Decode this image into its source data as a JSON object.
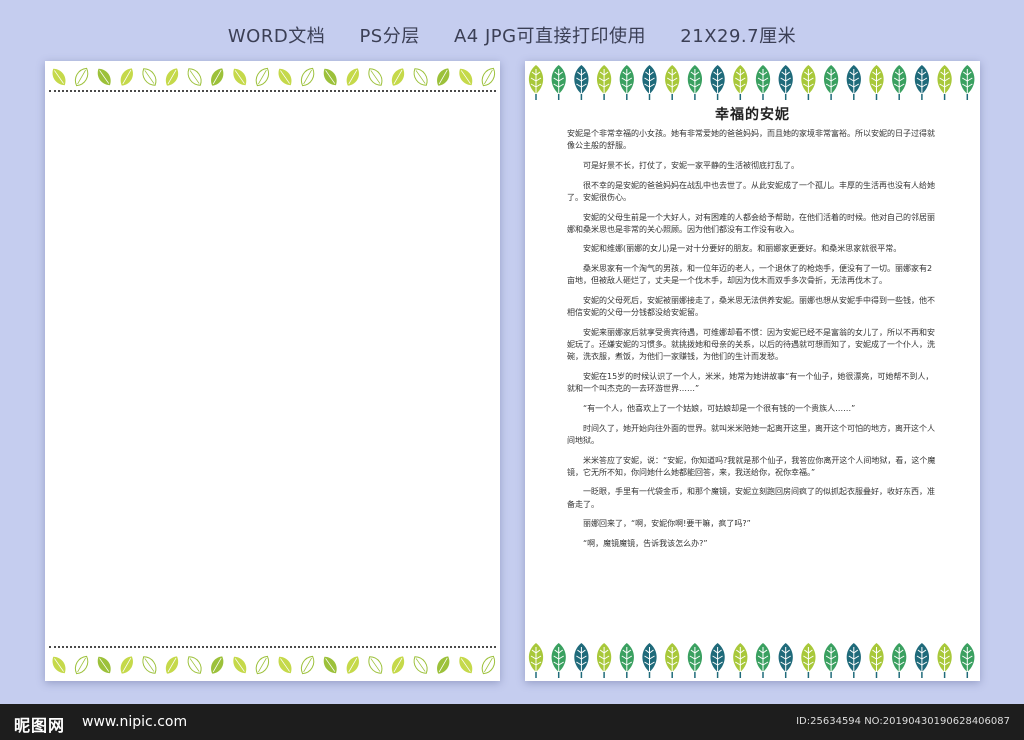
{
  "header": {
    "items": [
      "WORD文档",
      "PS分层",
      "A4 JPG可直接打印使用",
      "21X29.7厘米"
    ]
  },
  "colors": {
    "background": "#c5cdef",
    "leaf_light": "#c5d94a",
    "leaf_dark": "#9cc13a",
    "tree_dark": "#1f6a7a",
    "tree_mid": "#3aa060",
    "tree_light": "#a8c83a"
  },
  "icons": [
    "leaf-icon",
    "tree-icon"
  ],
  "document": {
    "title": "幸福的安妮",
    "paragraphs": [
      "安妮是个非常幸福的小女孩。她有非常爱她的爸爸妈妈，而且她的家境非常富裕。所以安妮的日子过得就像公主般的舒服。",
      "可是好景不长，打仗了，安妮一家平静的生活被彻底打乱了。",
      "很不幸的是安妮的爸爸妈妈在战乱中也去世了。从此安妮成了一个孤儿。丰厚的生活再也没有人给她了。安妮很伤心。",
      "安妮的父母生前是一个大好人，对有困难的人都会给予帮助，在他们活着的时候。他对自己的邻居丽娜和桑米思也是非常的关心照顾。因为他们都没有工作没有收入。",
      "安妮和维娜(丽娜的女儿)是一对十分要好的朋友。和丽娜家更要好。和桑米思家就很平常。",
      "桑米思家有一个淘气的男孩，和一位年迈的老人，一个退休了的枪炮手，便没有了一切。丽娜家有2亩地，但被敌人砸烂了，丈夫是一个伐木手，却因为伐木而双手多次骨折，无法再伐木了。",
      "安妮的父母死后，安妮被丽娜接走了，桑米思无法供养安妮。丽娜也想从安妮手中得到一些钱，他不相信安妮的父母一分钱都没给安妮留。",
      "安妮来丽娜家后就享受贵宾待遇，可维娜却看不惯：因为安妮已经不是富翁的女儿了，所以不再和安妮玩了。还嫌安妮的习惯多。就挑拨她和母亲的关系，以后的待遇就可想而知了，安妮成了一个仆人，洗碗，洗衣服，煮饭，为他们一家赚钱，为他们的生计而发愁。",
      "安妮在15岁的时候认识了一个人，米米，她常为她讲故事“有一个仙子，她很漂亮，可她帮不到人，就和一个叫杰克的一去环游世界……”",
      "“有一个人，他喜欢上了一个姑娘，可姑娘却是一个很有钱的一个贵族人……”",
      "时间久了，她开始向往外面的世界。就叫米米陪她一起离开这里，离开这个可怕的地方，离开这个人间地狱。",
      "米米答应了安妮，说：“安妮，你知道吗?我就是那个仙子，我答应你离开这个人间地狱，看，这个魔镜，它无所不知，你问她什么她都能回答，来，我送给你，祝你幸福。”",
      "一眨眼，手里有一代袋金币，和那个魔镜，安妮立刻跑回房间疯了的似抓起衣服叠好，收好东西，准备走了。",
      "丽娜回来了，“啊，安妮你啊!要干嘛，疯了吗?”",
      "“啊，魔镜魔镜，告诉我该怎么办?”"
    ]
  },
  "footer": {
    "logo": "昵图网",
    "url": "www.nipic.com",
    "id_text": "ID:25634594 NO:20190430190628406087"
  }
}
